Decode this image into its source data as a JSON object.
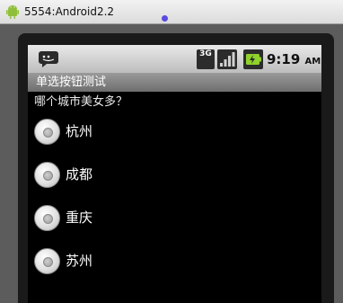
{
  "window": {
    "title": "5554:Android2.2"
  },
  "statusbar": {
    "message_icon": "message-icon",
    "network_label": "3G",
    "signal_icon": "signal-icon",
    "battery_icon": "battery-charging-icon",
    "time": "9:19",
    "ampm": "AM"
  },
  "app": {
    "title": "单选按钮测试",
    "question": "哪个城市美女多？",
    "options": [
      {
        "label": "杭州",
        "checked": false
      },
      {
        "label": "成都",
        "checked": false
      },
      {
        "label": "重庆",
        "checked": false
      },
      {
        "label": "苏州",
        "checked": false
      }
    ]
  }
}
